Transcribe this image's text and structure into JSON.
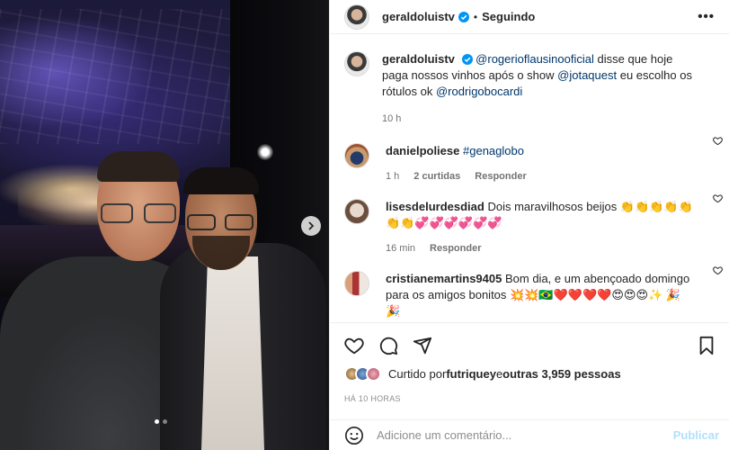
{
  "photo": {
    "carousel_dots": [
      true,
      false
    ]
  },
  "header": {
    "username": "geraldoluistv",
    "separator": "•",
    "follow_status": "Seguindo",
    "more_label": "•••"
  },
  "caption": {
    "username": "geraldoluistv",
    "mention1": "@rogerioflausinooficial",
    "text1": " disse que hoje paga nossos vinhos após o show ",
    "mention2": "@jotaquest",
    "text2": " eu escolho os rótulos ok ",
    "mention3": "@rodrigobocardi",
    "time": "10 h"
  },
  "comments": [
    {
      "username": "danielpoliese",
      "hashtag": "#genaglobo",
      "text": "",
      "time": "1 h",
      "likes": "2 curtidas",
      "reply": "Responder"
    },
    {
      "username": "lisesdelurdesdiad",
      "text": "Dois maravilhosos beijos",
      "emoji_line1": "👏👏👏👏👏",
      "emoji_line2": "👏👏💞💞💞💞💞💞",
      "time": "16 min",
      "reply": "Responder"
    },
    {
      "username": "cristianemartins9405",
      "text": "Bom dia, e um abençoado domingo para os amigos bonitos",
      "emoji_line": "💥💥🇧🇷❤️❤️❤️❤️😍😍😍✨",
      "emoji_line2": "🎉🎉"
    }
  ],
  "likes": {
    "prefix": "Curtido por ",
    "user": "futriquey",
    "middle": " e ",
    "others": "outras 3,959 pessoas"
  },
  "timestamp": "HÁ 10 HORAS",
  "add_comment": {
    "placeholder": "Adicione um comentário...",
    "publish_label": "Publicar"
  },
  "icons": {
    "verified": "verified-icon",
    "heart": "heart-icon",
    "comment": "comment-icon",
    "share": "share-icon",
    "save": "bookmark-icon",
    "emoji": "emoji-icon",
    "next": "chevron-right-icon"
  },
  "colors": {
    "verified": "#0095f6",
    "mention": "#00376b",
    "publish_disabled": "#b2dffc"
  }
}
